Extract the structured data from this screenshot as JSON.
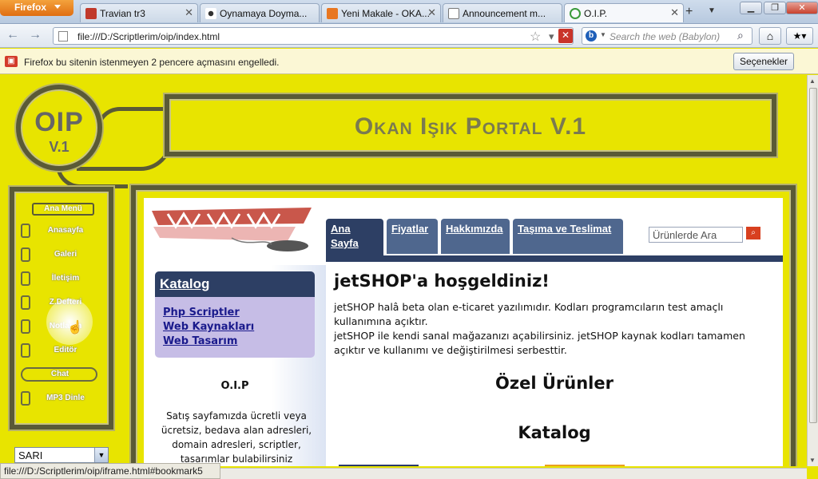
{
  "browser": {
    "menu_button": "Firefox",
    "tabs": [
      {
        "title": "Travian tr3",
        "active": false
      },
      {
        "title": "Oynamaya Doyma...",
        "active": false
      },
      {
        "title": "Yeni Makale - OKA...",
        "active": false
      },
      {
        "title": "Announcement m...",
        "active": false
      },
      {
        "title": "O.I.P.",
        "active": true
      }
    ],
    "new_tab": "+",
    "url": "file:///D:/Scriptlerim/oip/index.html",
    "search_placeholder": "Search the web (Babylon)",
    "notification_text": "Firefox bu sitenin istenmeyen 2 pencere açmasını engelledi.",
    "notification_button": "Seçenekler",
    "status_url": "file:///D:/Scriptlerim/oip/iframe.html#bookmark5"
  },
  "site": {
    "logo_main": "OIP",
    "logo_version": "V.1",
    "portal_title": "Okan Işık Portal V.1",
    "menu_header": "Ana Menü",
    "menu_items": [
      "Anasayfa",
      "Galeri",
      "İletişim",
      "Z.Defteri",
      "Notlarım",
      "Editör",
      "Chat",
      "MP3 Dinle"
    ],
    "theme_select_value": "SARI"
  },
  "shop": {
    "tabs": [
      {
        "label": "Ana Sayfa",
        "active": true
      },
      {
        "label": "Fiyatlar",
        "active": false
      },
      {
        "label": "Hakkımızda",
        "active": false
      },
      {
        "label": "Taşıma ve Teslimat",
        "active": false
      }
    ],
    "search_placeholder": "Ürünlerde Ara",
    "catalog_title": "Katalog",
    "catalog_links": [
      "Php Scriptler",
      "Web Kaynakları",
      "Web Tasarım"
    ],
    "side_heading": "O.I.P",
    "side_text": "Satış sayfamızda ücretli veya ücretsiz, bedava alan adresleri, domain adresleri, scriptler, tasarımlar bulabilirsiniz",
    "welcome": "jetSHOP'a hoşgeldiniz!",
    "intro_1": "jetSHOP halâ beta olan e-ticaret yazılımıdır. Kodları programcıların test amaçlı kullanımına açıktır.",
    "intro_2": "jetSHOP ile kendi sanal mağazanızı açabilirsiniz. jetSHOP kaynak kodları tamamen açıktır ve kullanımı ve değiştirilmesi serbesttir.",
    "featured_title": "Özel Ürünler",
    "catalog_section_title": "Katalog"
  }
}
